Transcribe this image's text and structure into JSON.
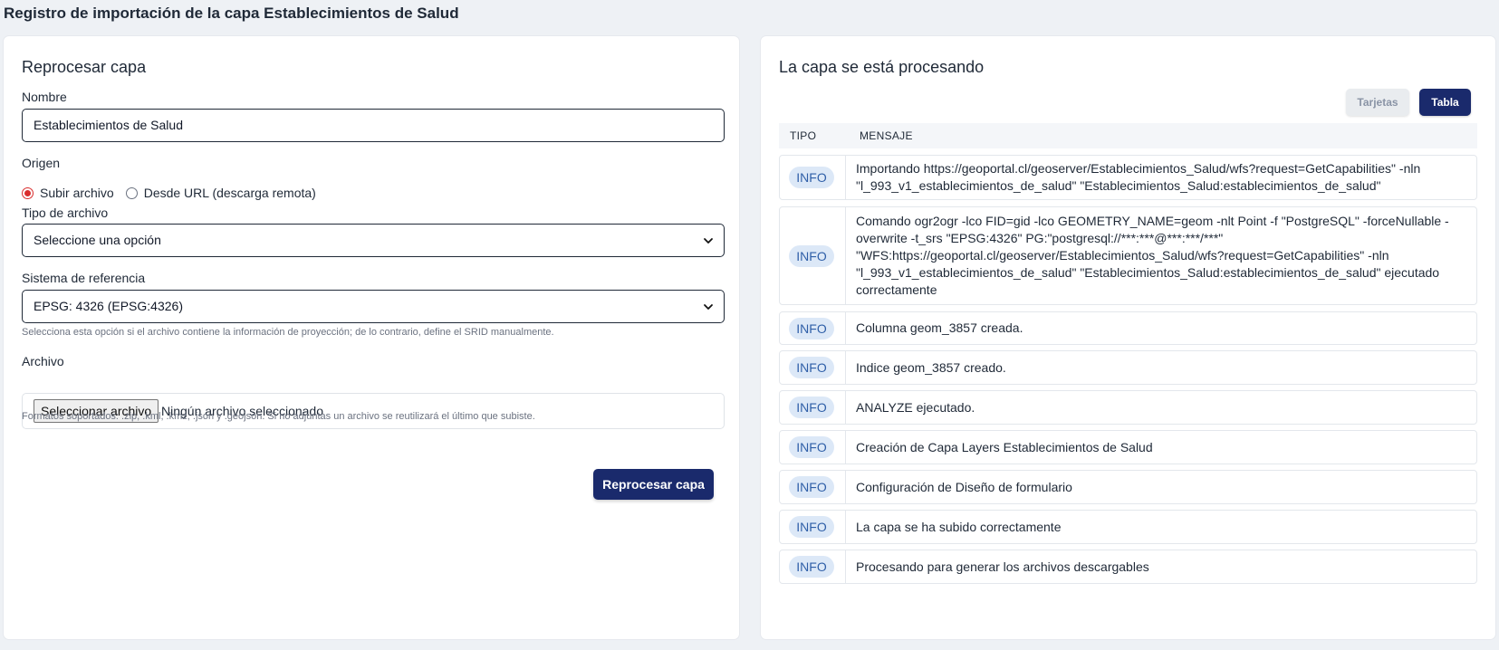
{
  "page": {
    "title": "Registro de importación de la capa Establecimientos de Salud"
  },
  "form": {
    "heading": "Reprocesar capa",
    "nombre_label": "Nombre",
    "nombre_value": "Establecimientos de Salud",
    "origen_label": "Origen",
    "origen_options": [
      "Subir archivo",
      "Desde URL (descarga remota)"
    ],
    "origen_selected": "Subir archivo",
    "tipo_label": "Tipo de archivo",
    "tipo_value": "Seleccione una opción",
    "srs_label": "Sistema de referencia",
    "srs_value": "EPSG: 4326 (EPSG:4326)",
    "srs_help": "Selecciona esta opción si el archivo contiene la información de proyección; de lo contrario, define el SRID manualmente.",
    "archivo_label": "Archivo",
    "file_button": "Seleccionar archivo",
    "file_none": "Ningún archivo seleccionado",
    "formats_help": "Formatos soportados: .zip, .kml, .kmz, .json y .geojson. Si no adjuntas un archivo se reutilizará el último que subiste.",
    "submit_label": "Reprocesar capa",
    "accent_color": "#1a2a6c",
    "radio_color": "#d92d2d"
  },
  "status": {
    "heading": "La capa se está procesando",
    "view_toggle": {
      "cards": "Tarjetas",
      "table": "Tabla",
      "active": "Tabla"
    },
    "columns": [
      "TIPO",
      "MENSAJE"
    ],
    "logs": [
      {
        "type": "INFO",
        "message": "Importando https://geoportal.cl/geoserver/Establecimientos_Salud/wfs?request=GetCapabilities\" -nln \"l_993_v1_establecimientos_de_salud\" \"Establecimientos_Salud:establecimientos_de_salud\""
      },
      {
        "type": "INFO",
        "message": "Comando ogr2ogr -lco FID=gid -lco GEOMETRY_NAME=geom -nlt Point -f \"PostgreSQL\" -forceNullable -overwrite -t_srs \"EPSG:4326\" PG:\"postgresql://***:***@***:***/***\" \"WFS:https://geoportal.cl/geoserver/Establecimientos_Salud/wfs?request=GetCapabilities\" -nln \"l_993_v1_establecimientos_de_salud\" \"Establecimientos_Salud:establecimientos_de_salud\" ejecutado correctamente"
      },
      {
        "type": "INFO",
        "message": "Columna geom_3857 creada."
      },
      {
        "type": "INFO",
        "message": "Indice geom_3857 creado."
      },
      {
        "type": "INFO",
        "message": "ANALYZE ejecutado."
      },
      {
        "type": "INFO",
        "message": "Creación de Capa Layers Establecimientos de Salud"
      },
      {
        "type": "INFO",
        "message": "Configuración de Diseño de formulario"
      },
      {
        "type": "INFO",
        "message": "La capa se ha subido correctamente"
      },
      {
        "type": "INFO",
        "message": "Procesando para generar los archivos descargables"
      }
    ],
    "badge_bg": "#dce8f7",
    "badge_text": "#2f5fa8"
  }
}
